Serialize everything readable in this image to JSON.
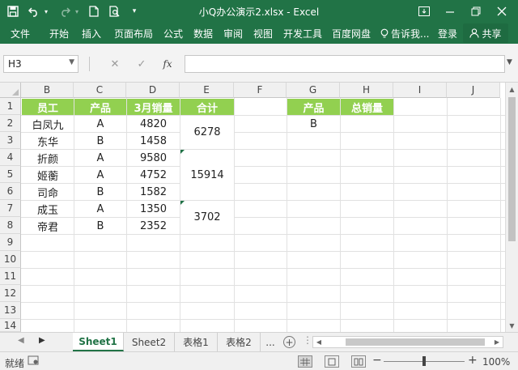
{
  "titlebar": {
    "title": "小Q办公演示2.xlsx - Excel",
    "qa_icons": [
      "save-icon",
      "undo-icon",
      "redo-icon",
      "new-file-icon",
      "print-preview-icon",
      "customize-icon"
    ],
    "window_icons": [
      "ribbon-display-icon",
      "minimize-icon",
      "restore-icon",
      "close-icon"
    ]
  },
  "ribbon": {
    "tabs": [
      "文件",
      "开始",
      "插入",
      "页面布局",
      "公式",
      "数据",
      "审阅",
      "视图",
      "开发工具",
      "百度网盘"
    ],
    "tell_me": "告诉我...",
    "login": "登录",
    "share": "共享",
    "colors": {
      "accent": "#217346"
    }
  },
  "formula_bar": {
    "name_box": "H3",
    "fx_label": "fx",
    "formula": ""
  },
  "sheet": {
    "columns": [
      "B",
      "C",
      "D",
      "E",
      "F",
      "G",
      "H",
      "I",
      "J"
    ],
    "rows": [
      "1",
      "2",
      "3",
      "4",
      "5",
      "6",
      "7",
      "8",
      "9",
      "10",
      "11",
      "12",
      "13",
      "14"
    ],
    "headers": {
      "employee": "员工",
      "product": "产品",
      "march_sales": "3月销量",
      "total": "合计"
    },
    "records": [
      {
        "employee": "白凤九",
        "product": "A",
        "sales": "4820"
      },
      {
        "employee": "东华",
        "product": "B",
        "sales": "1458"
      },
      {
        "employee": "折颜",
        "product": "A",
        "sales": "9580"
      },
      {
        "employee": "姬蘅",
        "product": "A",
        "sales": "4752"
      },
      {
        "employee": "司命",
        "product": "B",
        "sales": "1582"
      },
      {
        "employee": "成玉",
        "product": "A",
        "sales": "1350"
      },
      {
        "employee": "帝君",
        "product": "B",
        "sales": "2352"
      }
    ],
    "totals": [
      "6278",
      "15914",
      "3702"
    ],
    "lookup": {
      "product_header": "产品",
      "sum_header": "总销量",
      "product_value": "B",
      "sum_value": ""
    },
    "colors": {
      "header_fill": "#92d050",
      "header_text": "#ffffff"
    }
  },
  "sheet_tabs": {
    "tabs": [
      "Sheet1",
      "Sheet2",
      "表格1",
      "表格2"
    ],
    "active": "Sheet1",
    "more": "..."
  },
  "statusbar": {
    "status": "就绪",
    "zoom": "100%"
  }
}
